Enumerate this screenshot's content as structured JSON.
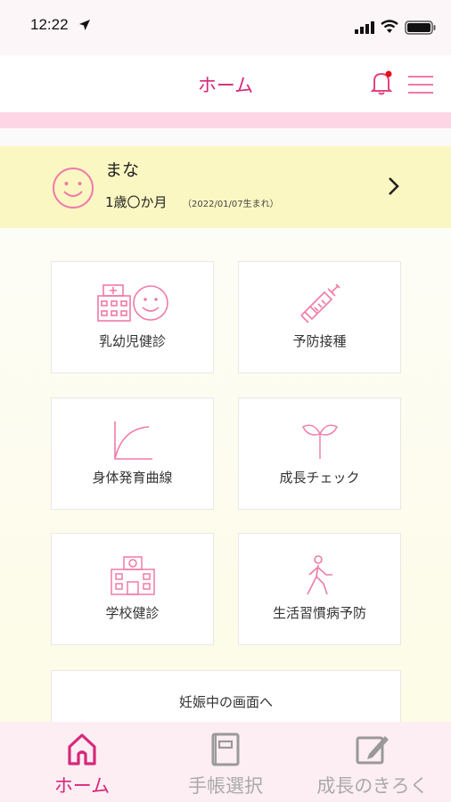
{
  "status_bar": {
    "time": "12:22",
    "icons": [
      "location-arrow-icon",
      "signal-icon",
      "wifi-icon",
      "battery-icon"
    ]
  },
  "header": {
    "title": "ホーム",
    "icons": [
      "bell-icon",
      "menu-icon"
    ],
    "notification_dot": true
  },
  "profile": {
    "name": "まな",
    "age": "1歳〇か月",
    "birth": "（2022/01/07生まれ）",
    "icon": "smile-icon"
  },
  "tiles": [
    {
      "label": "乳幼児健診",
      "icon": "hospital-smile-icon"
    },
    {
      "label": "予防接種",
      "icon": "syringe-icon"
    },
    {
      "label": "身体発育曲線",
      "icon": "growth-curve-icon"
    },
    {
      "label": "成長チェック",
      "icon": "sprout-icon"
    },
    {
      "label": "学校健診",
      "icon": "school-icon"
    },
    {
      "label": "生活習慣病予防",
      "icon": "walking-person-icon"
    }
  ],
  "pregnancy_button": {
    "label": "妊娠中の画面へ"
  },
  "tabbar": {
    "items": [
      {
        "label": "ホーム",
        "icon": "home-icon",
        "active": true
      },
      {
        "label": "手帳選択",
        "icon": "notebook-icon",
        "active": false
      },
      {
        "label": "成長のきろく",
        "icon": "edit-icon",
        "active": false
      }
    ]
  },
  "colors": {
    "accent": "#d6287a",
    "icon_pink": "#f07aa8",
    "profile_bg": "#fbf7c2",
    "band_pink": "#fcd6e4",
    "tab_bg": "#fdeef3"
  }
}
